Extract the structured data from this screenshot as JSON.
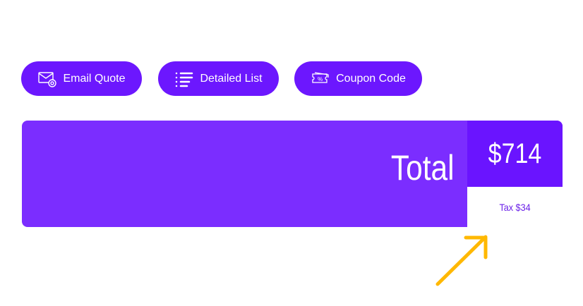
{
  "buttons": [
    {
      "label": "Email Quote",
      "icon": "email-at-icon"
    },
    {
      "label": "Detailed List",
      "icon": "list-icon"
    },
    {
      "label": "Coupon Code",
      "icon": "coupon-icon"
    }
  ],
  "summary": {
    "total_label": "Total",
    "total_value": "$714",
    "tax": "Tax $34"
  },
  "colors": {
    "accent": "#6c17fe",
    "panel": "#7b2dff",
    "arrow": "#ffb800"
  }
}
